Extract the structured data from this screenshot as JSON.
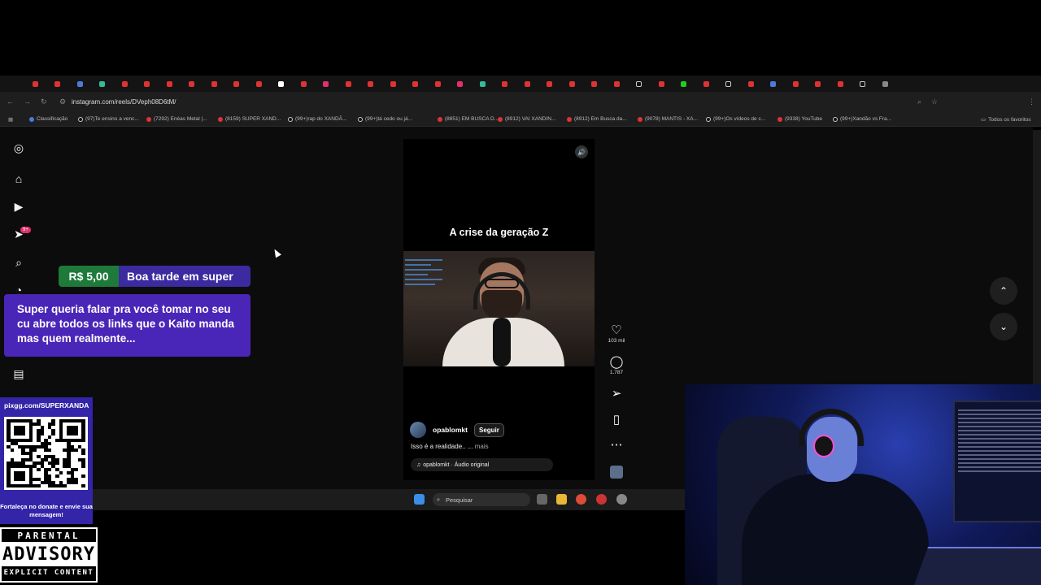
{
  "browser": {
    "url": "instagram.com/reels/DVeph08D6tM/",
    "all_bookmarks_label": "Todos os favoritos",
    "bookmarks": [
      {
        "label": "Classificação",
        "kind": "gl"
      },
      {
        "label": "(97)Te ensino a venc...",
        "kind": "tt"
      },
      {
        "label": "(7292) Enéas Metal |...",
        "kind": "yt"
      },
      {
        "label": "(8159) SUPER XAND...",
        "kind": "yt"
      },
      {
        "label": "(99+)rap do XANDÃ...",
        "kind": "tt"
      },
      {
        "label": "(99+)tá cedo ou já...",
        "kind": "tt"
      },
      {
        "label": "(8851) EM BUSCA D...",
        "kind": "yt"
      },
      {
        "label": "(8912) VAI XANDIN...",
        "kind": "yt"
      },
      {
        "label": "(8912) Em Busca da...",
        "kind": "yt"
      },
      {
        "label": "(9078) MANTIS - XA...",
        "kind": "yt"
      },
      {
        "label": "(99+)Os vídeos de c...",
        "kind": "tt"
      },
      {
        "label": "(9338) YouTube",
        "kind": "yt"
      },
      {
        "label": "(99+)Xandão vs Fra...",
        "kind": "tt"
      }
    ]
  },
  "sidebar": {
    "notifications_badge": "9+"
  },
  "reel": {
    "title": "A crise da geração Z",
    "author": "opablomkt",
    "follow_label": "Seguir",
    "caption": "Isso é a realidade.. ...",
    "caption_more": "mais",
    "audio": "opablomkt · Áudio original",
    "likes": "103 mil",
    "comments": "1.787"
  },
  "donation": {
    "amount": "R$ 5,00",
    "name": "Boa tarde em super",
    "message": "Super queria falar pra você tomar no seu cu abre todos os links que o Kaito manda mas quem realmente..."
  },
  "qr_panel": {
    "url": "pixgg.com/SUPERXANDA",
    "caption": "Fortaleça no donate e envie sua mensagem!"
  },
  "advisory": {
    "line1": "PARENTAL",
    "line2": "ADVISORY",
    "line3": "EXPLICIT CONTENT"
  },
  "taskbar": {
    "search_placeholder": "Pesquisar"
  }
}
